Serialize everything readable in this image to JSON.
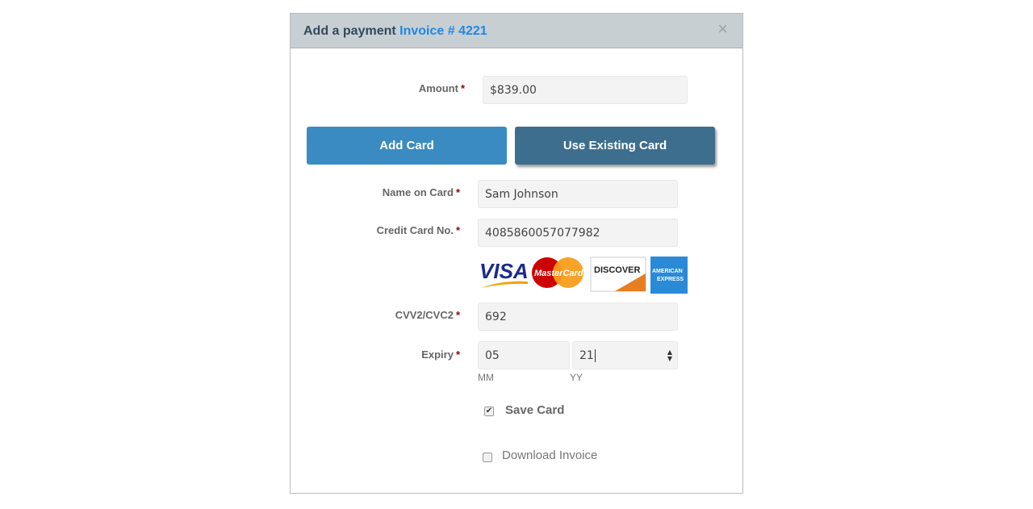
{
  "dialog": {
    "title": "Add a payment",
    "invoice": "Invoice # 4221",
    "close": "×"
  },
  "amount": {
    "label": "Amount",
    "required": "*",
    "value": "$839.00"
  },
  "buttons": {
    "add_card": "Add Card",
    "use_existing": "Use Existing Card"
  },
  "name": {
    "label": "Name on Card",
    "required": "*",
    "value": "Sam Johnson"
  },
  "card_no": {
    "label": "Credit Card No.",
    "required": "*",
    "value": "4085860057077982"
  },
  "logos": {
    "visa": "VISA",
    "mastercard": "MasterCard",
    "discover": "DISCOVER",
    "amex": "AMERICAN EXPRESS"
  },
  "cvv": {
    "label": "CVV2/CVC2",
    "required": "*",
    "value": "692"
  },
  "expiry": {
    "label": "Expiry",
    "required": "*",
    "month": "05",
    "year": "21",
    "month_hint": "MM",
    "year_hint": "YY"
  },
  "save_card": {
    "label": "Save Card",
    "checked": true,
    "mark": "✔"
  },
  "download": {
    "label": "Download Invoice",
    "checked": false
  }
}
